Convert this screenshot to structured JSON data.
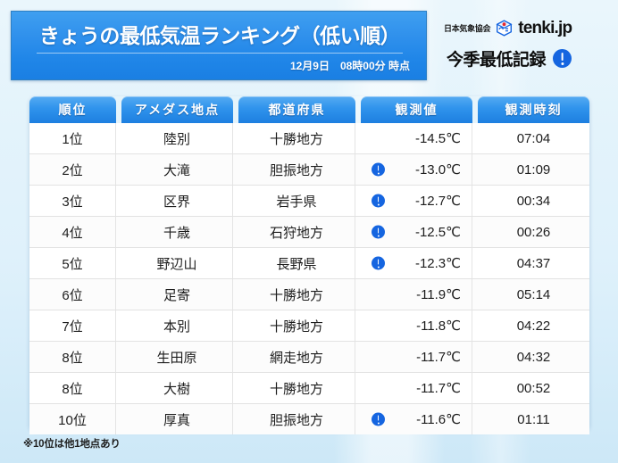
{
  "header": {
    "title": "きょうの最低気温ランキング（低い順）",
    "subtitle": "12月9日　08時00分 時点",
    "brand_association": "日本気象協会",
    "brand_name": "tenki.jp",
    "brand_logo_icon": "tenki-cube-icon",
    "record_label": "今季最低記録",
    "record_icon": "exclamation-circle-icon",
    "banner_color": "#2086e8",
    "accent_color": "#1565e0"
  },
  "table": {
    "columns": [
      "順位",
      "アメダス地点",
      "都道府県",
      "観測値",
      "観測時刻"
    ],
    "rows": [
      {
        "rank": "1位",
        "station": "陸別",
        "prefecture": "十勝地方",
        "record": false,
        "temp": "-14.5℃",
        "time": "07:04"
      },
      {
        "rank": "2位",
        "station": "大滝",
        "prefecture": "胆振地方",
        "record": true,
        "temp": "-13.0℃",
        "time": "01:09"
      },
      {
        "rank": "3位",
        "station": "区界",
        "prefecture": "岩手県",
        "record": true,
        "temp": "-12.7℃",
        "time": "00:34"
      },
      {
        "rank": "4位",
        "station": "千歳",
        "prefecture": "石狩地方",
        "record": true,
        "temp": "-12.5℃",
        "time": "00:26"
      },
      {
        "rank": "5位",
        "station": "野辺山",
        "prefecture": "長野県",
        "record": true,
        "temp": "-12.3℃",
        "time": "04:37"
      },
      {
        "rank": "6位",
        "station": "足寄",
        "prefecture": "十勝地方",
        "record": false,
        "temp": "-11.9℃",
        "time": "05:14"
      },
      {
        "rank": "7位",
        "station": "本別",
        "prefecture": "十勝地方",
        "record": false,
        "temp": "-11.8℃",
        "time": "04:22"
      },
      {
        "rank": "8位",
        "station": "生田原",
        "prefecture": "網走地方",
        "record": false,
        "temp": "-11.7℃",
        "time": "04:32"
      },
      {
        "rank": "8位",
        "station": "大樹",
        "prefecture": "十勝地方",
        "record": false,
        "temp": "-11.7℃",
        "time": "00:52"
      },
      {
        "rank": "10位",
        "station": "厚真",
        "prefecture": "胆振地方",
        "record": true,
        "temp": "-11.6℃",
        "time": "01:11"
      }
    ]
  },
  "footnote": "※10位は他1地点あり"
}
